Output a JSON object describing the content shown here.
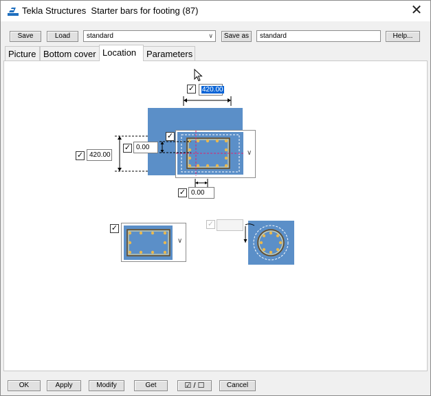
{
  "titlebar": {
    "title": "Tekla Structures  Starter bars for footing (87)",
    "close_glyph": "✕",
    "app_icon": "tekla-icon"
  },
  "toolbar": {
    "save_label": "Save",
    "load_label": "Load",
    "load_value": "standard",
    "save_as_label": "Save as",
    "save_as_value": "standard",
    "help_label": "Help..."
  },
  "tabs": [
    {
      "label": "Picture",
      "active": false
    },
    {
      "label": "Bottom cover",
      "active": false
    },
    {
      "label": "Location",
      "active": true
    },
    {
      "label": "Parameters",
      "active": false
    }
  ],
  "location": {
    "top_width": "420.00",
    "left_height": "420.00",
    "offset_y": "0.00",
    "offset_x": "0.00",
    "round_value": "",
    "check_glyph": "✓"
  },
  "footer": {
    "ok_label": "OK",
    "apply_label": "Apply",
    "modify_label": "Modify",
    "get_label": "Get",
    "toggle_label": "☑ / ☐",
    "cancel_label": "Cancel"
  },
  "colors": {
    "footing_blue": "#5b8fc8",
    "selection_blue": "#0a64d6",
    "window_bg": "#f0f0f0"
  }
}
